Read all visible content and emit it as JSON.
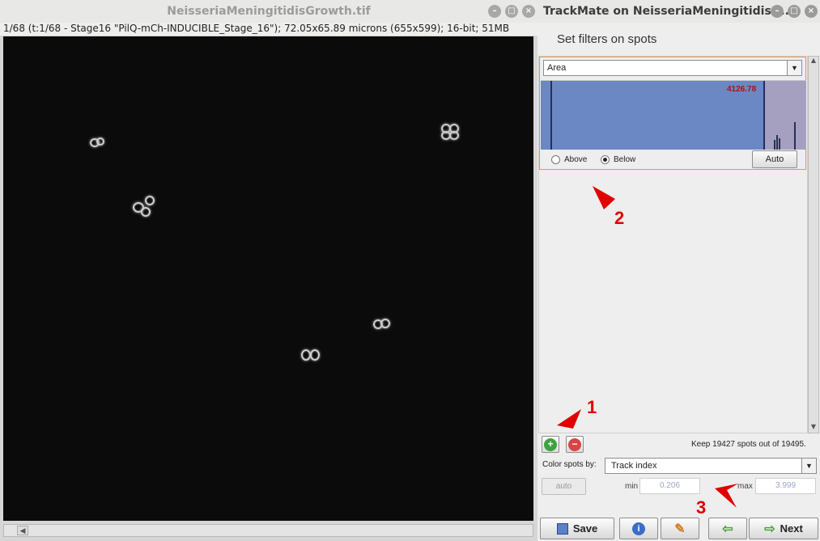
{
  "image_window": {
    "title": "NeisseriaMeningitidisGrowth.tif",
    "info": "1/68 (t:1/68 - Stage16 \"PilQ-mCh-INDUCIBLE_Stage_16\"); 72.05x65.89 microns (655x599); 16-bit; 51MB",
    "scroll_left": "◀"
  },
  "trackmate_window": {
    "title": "TrackMate on NeisseriaMeningitidisG...",
    "heading": "Set filters on spots",
    "filter": {
      "feature": "Area",
      "threshold_value": "4126.78",
      "threshold_fraction": 0.84,
      "above_label": "Above",
      "below_label": "Below",
      "selected": "Below",
      "auto_label": "Auto"
    },
    "summary": "Keep 19427 spots out of  19495.",
    "color_by": {
      "label": "Color spots by:",
      "value": "Track index",
      "auto_label": "auto",
      "min_label": "min",
      "min_value": "0.206",
      "max_label": "max",
      "max_value": "3.999"
    },
    "buttons": {
      "save": "Save",
      "next": "Next"
    }
  },
  "annotations": {
    "one": "1",
    "two": "2",
    "three": "3",
    "color": "#e00000"
  },
  "icons": [
    "minimize-icon",
    "maximize-icon",
    "close-icon",
    "add-icon",
    "remove-icon",
    "save-icon",
    "info-icon",
    "wrench-icon",
    "back-arrow-icon",
    "next-arrow-icon"
  ]
}
